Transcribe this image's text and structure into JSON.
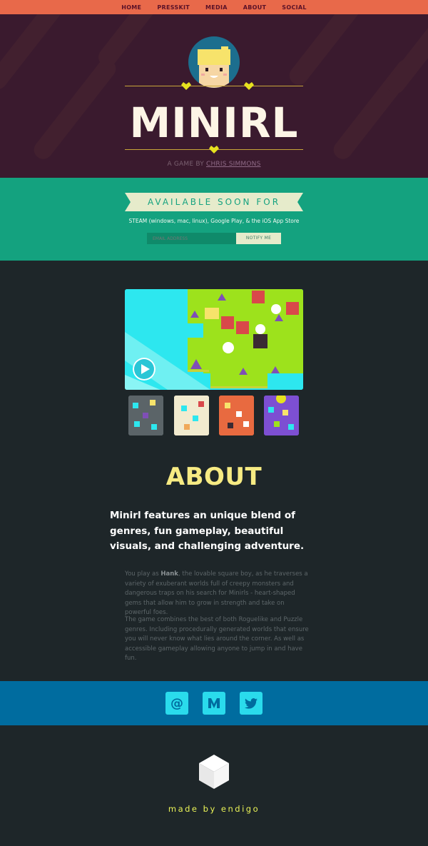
{
  "nav": {
    "items": [
      "HOME",
      "PRESSKIT",
      "MEDIA",
      "ABOUT",
      "SOCIAL"
    ]
  },
  "hero": {
    "title": "MINIRL",
    "byline_prefix": "A GAME BY",
    "byline_author": "CHRIS SIMMONS"
  },
  "availability": {
    "banner": "AVAILABLE SOON FOR",
    "platforms": "STEAM (windows, mac, linux), Google Play, & the iOS App Store",
    "email_placeholder": "EMAIL ADDRESS",
    "notify_label": "NOTIFY ME"
  },
  "media": {
    "play_icon": "play-icon",
    "thumbnails": [
      "dark-world",
      "cream-world",
      "orange-world",
      "purple-world"
    ]
  },
  "about": {
    "title": "ABOUT",
    "lead": "Minirl features an unique blend of genres, fun gameplay, beautiful visuals, and challenging adventure.",
    "p1_before": "You play as ",
    "p1_bold": "Hank",
    "p1_after": ", the lovable square boy, as he traverses a variety of exuberant worlds full of creepy monsters and dangerous traps on his search for Minirls - heart-shaped gems that allow him to grow in strength and take on powerful foes.",
    "p2": "The game combines the best of both Roguelike and Puzzle genres. Including procedurally generated worlds that ensure you will never know what lies around the corner. As well as accessible gameplay allowing anyone to jump in and have fun."
  },
  "social": {
    "items": [
      {
        "icon": "at-icon",
        "glyph": "@"
      },
      {
        "icon": "medium-icon",
        "glyph": "M"
      },
      {
        "icon": "twitter-icon",
        "glyph": ""
      }
    ]
  },
  "footer": {
    "credit": "made by endigo"
  },
  "colors": {
    "nav": "#e8694a",
    "hero": "#3a1a2e",
    "teal": "#14a27f",
    "dark": "#1e2629",
    "about_title": "#f7eb83",
    "social_bar": "#006c9f",
    "social_button": "#2adbec",
    "footer_text": "#eaf357"
  }
}
